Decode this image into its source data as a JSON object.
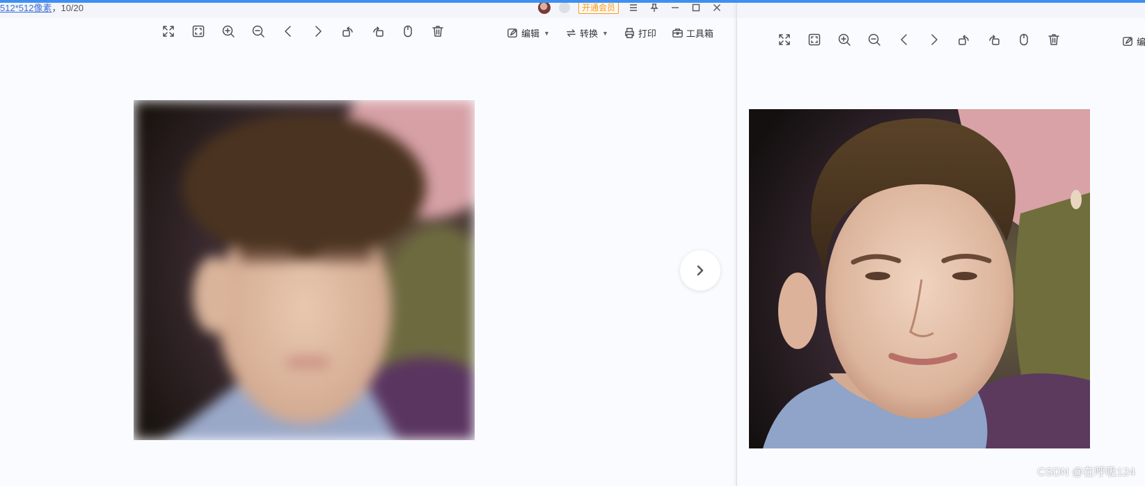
{
  "left_pane": {
    "info_dims": "512*512像素",
    "info_sep": "，",
    "info_page": "10/20",
    "vip_label": "开通会员"
  },
  "toolbar": {
    "icons": [
      "fullscreen-icon",
      "fit-window-icon",
      "zoom-in-icon",
      "zoom-out-icon",
      "prev-icon",
      "next-icon",
      "rotate-left-icon",
      "rotate-right-icon",
      "mouse-icon",
      "trash-icon"
    ],
    "edit_label": "编辑",
    "convert_label": "转换",
    "print_label": "打印",
    "toolbox_label": "工具箱",
    "right_edit_partial": "编"
  },
  "viewer": {
    "left_image": "blurred-face-photo",
    "right_image": "restored-face-photo",
    "next_icon": "chevron-right-icon"
  },
  "watermark": "CSDN @在呼吸124",
  "colors": {
    "accent": "#3e8ff0",
    "vip": "#f59a23",
    "background": "#fafbfe"
  }
}
